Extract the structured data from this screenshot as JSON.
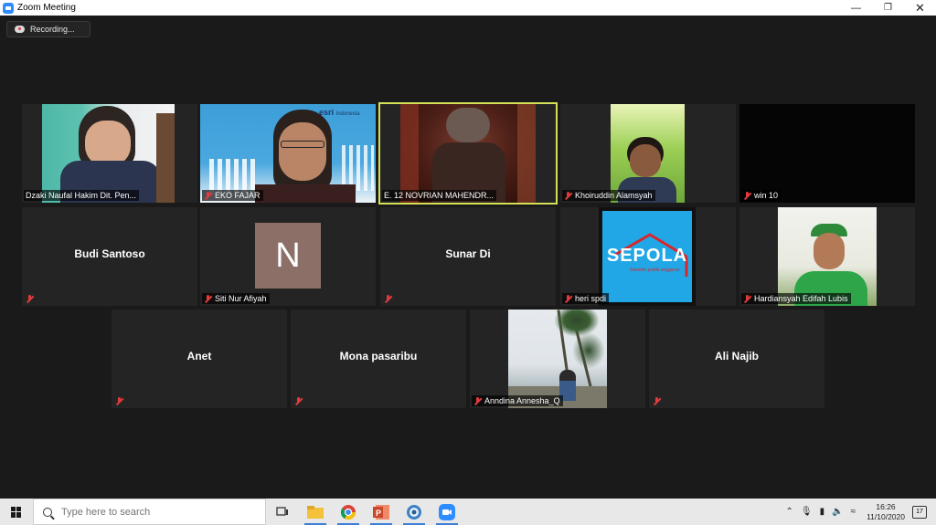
{
  "window": {
    "title": "Zoom Meeting",
    "minimize_icon": "minimize-icon",
    "restore_icon": "restore-icon",
    "close_icon": "close-icon"
  },
  "recording": {
    "label": "Recording..."
  },
  "participants": [
    {
      "name": "Dzaki Naufal Hakim Dit. Pen...",
      "video": true,
      "muted": false
    },
    {
      "name": "EKO FAJAR",
      "video": true,
      "muted": true
    },
    {
      "name": "E. 12 NOVRIAN MAHENDR...",
      "video": true,
      "muted": false,
      "active_speaker": true
    },
    {
      "name": "Khoiruddin Alamsyah",
      "video": true,
      "muted": true
    },
    {
      "name": "win 10",
      "video": false,
      "muted": true
    },
    {
      "name": "Budi Santoso",
      "video": false,
      "muted": true
    },
    {
      "name": "Siti Nur Afiyah",
      "video": false,
      "muted": true,
      "avatar_letter": "N"
    },
    {
      "name": "Sunar Di",
      "video": false,
      "muted": true
    },
    {
      "name": "heri spdi",
      "video": true,
      "muted": true,
      "logo_text": "SEPOLA",
      "logo_sub": "Sekolah politik anggaran"
    },
    {
      "name": "Hardiansyah Edifah Lubis",
      "video": true,
      "muted": true
    },
    {
      "name": "Anet",
      "video": false,
      "muted": true
    },
    {
      "name": "Mona pasaribu",
      "video": false,
      "muted": true
    },
    {
      "name": "Anndina Annesha_Q",
      "video": true,
      "muted": true
    },
    {
      "name": "Ali Najib",
      "video": false,
      "muted": true
    }
  ],
  "eko_background": {
    "brand": "esri",
    "brand_sub": "Indonesia"
  },
  "taskbar": {
    "search_placeholder": "Type here to search",
    "time": "16:26",
    "date": "11/10/2020",
    "notification_count": "17"
  }
}
